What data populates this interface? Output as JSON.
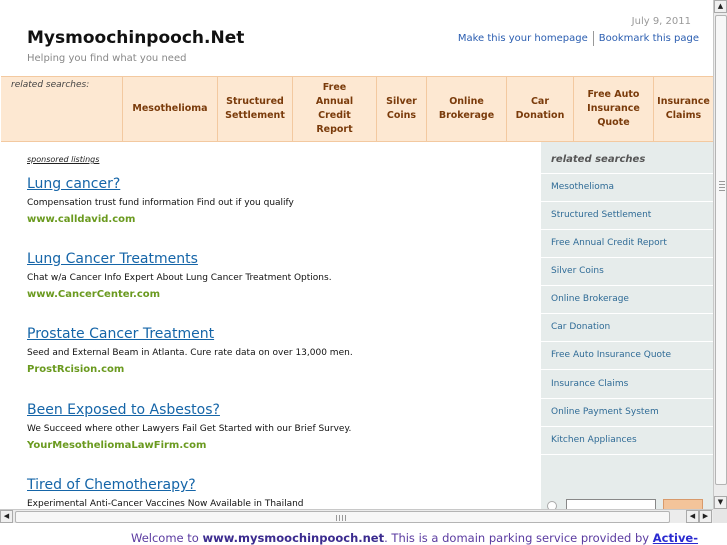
{
  "header": {
    "title": "Mysmoochinpooch.Net",
    "tagline": "Helping you find what you need",
    "date": "July 9, 2011",
    "homepage_link": "Make this your homepage",
    "bookmark_link": "Bookmark this page"
  },
  "related_bar": {
    "label": "related searches:",
    "items": [
      {
        "label": "Mesothelioma"
      },
      {
        "label": "Structured\nSettlement"
      },
      {
        "label": "Free\nAnnual\nCredit\nReport"
      },
      {
        "label": "Silver\nCoins"
      },
      {
        "label": "Online\nBrokerage"
      },
      {
        "label": "Car\nDonation"
      },
      {
        "label": "Free Auto\nInsurance\nQuote"
      },
      {
        "label": "Insurance\nClaims"
      }
    ]
  },
  "listings": {
    "label": "sponsored listings",
    "items": [
      {
        "title": "Lung cancer?",
        "desc": "Compensation trust fund information Find out if you qualify",
        "url": "www.calldavid.com"
      },
      {
        "title": "Lung Cancer Treatments",
        "desc": "Chat w/a Cancer Info Expert About Lung Cancer Treatment Options.",
        "url": "www.CancerCenter.com"
      },
      {
        "title": "Prostate Cancer Treatment",
        "desc": "Seed and External Beam in Atlanta. Cure rate data on over 13,000 men.",
        "url": "ProstRcision.com"
      },
      {
        "title": "Been Exposed to Asbestos?",
        "desc": "We Succeed where other Lawyers Fail Get Started with our Brief Survey.",
        "url": "YourMesotheliomaLawFirm.com"
      },
      {
        "title": "Tired of Chemotherapy?",
        "desc": "Experimental Anti-Cancer Vaccines Now Available in Thailand",
        "url": ""
      }
    ]
  },
  "sidebar": {
    "heading": "related searches",
    "items": [
      "Mesothelioma",
      "Structured Settlement",
      "Free Annual Credit Report",
      "Silver Coins",
      "Online Brokerage",
      "Car Donation",
      "Free Auto Insurance Quote",
      "Insurance Claims",
      "Online Payment System",
      "Kitchen Appliances"
    ]
  },
  "footer": {
    "prefix": "Welcome to ",
    "domain": "www.mysmoochinpooch.net",
    "middle": ". This is a domain parking service provided by ",
    "link": "Active-"
  },
  "colors": {
    "accent_orange": "#fde8d2",
    "link_blue": "#1565a8",
    "url_green": "#6a9a1f",
    "sidebar_bg": "#e6eceb"
  }
}
